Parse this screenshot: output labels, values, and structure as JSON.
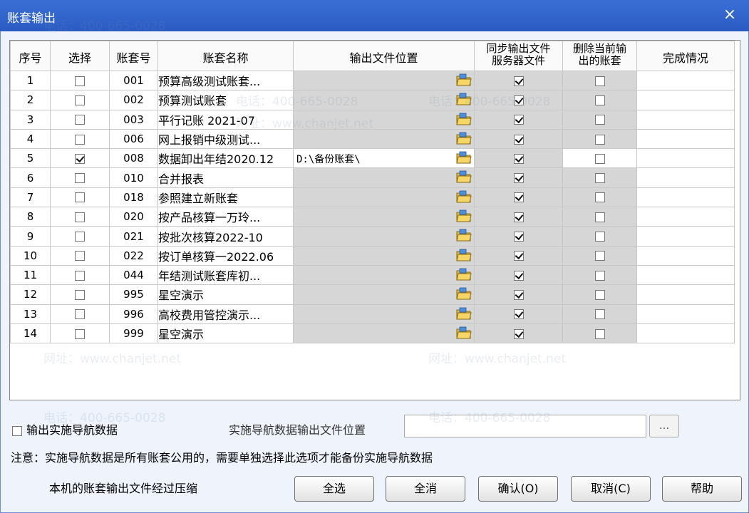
{
  "window": {
    "title": "账套输出",
    "close_label": "×"
  },
  "columns": [
    "序号",
    "选择",
    "账套号",
    "账套名称",
    "输出文件位置",
    "同步输出文件服务器文件",
    "删除当前输出的账套",
    "完成情况"
  ],
  "columns_display": {
    "sync_line1": "同步输出文件",
    "sync_line2": "服务器文件",
    "del_line1": "删除当前输",
    "del_line2": "出的账套"
  },
  "rows": [
    {
      "no": "1",
      "selected": false,
      "code": "001",
      "name": "预算高级测试账套...",
      "path": "",
      "sync": true,
      "delete": false,
      "status": ""
    },
    {
      "no": "2",
      "selected": false,
      "code": "002",
      "name": "预算测试账套",
      "path": "",
      "sync": true,
      "delete": false,
      "status": ""
    },
    {
      "no": "3",
      "selected": false,
      "code": "003",
      "name": "平行记账 2021-07",
      "path": "",
      "sync": true,
      "delete": false,
      "status": ""
    },
    {
      "no": "4",
      "selected": false,
      "code": "006",
      "name": "网上报销中级测试...",
      "path": "",
      "sync": true,
      "delete": false,
      "status": ""
    },
    {
      "no": "5",
      "selected": true,
      "code": "008",
      "name": "数据卸出年结2020.12",
      "path": "D:\\备份账套\\",
      "sync": true,
      "delete": false,
      "status": ""
    },
    {
      "no": "6",
      "selected": false,
      "code": "010",
      "name": "合并报表",
      "path": "",
      "sync": true,
      "delete": false,
      "status": ""
    },
    {
      "no": "7",
      "selected": false,
      "code": "018",
      "name": "参照建立新账套",
      "path": "",
      "sync": true,
      "delete": false,
      "status": ""
    },
    {
      "no": "8",
      "selected": false,
      "code": "020",
      "name": "按产品核算一万玲...",
      "path": "",
      "sync": true,
      "delete": false,
      "status": ""
    },
    {
      "no": "9",
      "selected": false,
      "code": "021",
      "name": "按批次核算2022-10",
      "path": "",
      "sync": true,
      "delete": false,
      "status": ""
    },
    {
      "no": "10",
      "selected": false,
      "code": "022",
      "name": "按订单核算一2022.06",
      "path": "",
      "sync": true,
      "delete": false,
      "status": ""
    },
    {
      "no": "11",
      "selected": false,
      "code": "044",
      "name": "年结测试账套库初...",
      "path": "",
      "sync": true,
      "delete": false,
      "status": ""
    },
    {
      "no": "12",
      "selected": false,
      "code": "995",
      "name": "星空演示",
      "path": "",
      "sync": true,
      "delete": false,
      "status": ""
    },
    {
      "no": "13",
      "selected": false,
      "code": "996",
      "name": "高校费用管控演示...",
      "path": "",
      "sync": true,
      "delete": false,
      "status": ""
    },
    {
      "no": "14",
      "selected": false,
      "code": "999",
      "name": "星空演示",
      "path": "",
      "sync": true,
      "delete": false,
      "status": ""
    }
  ],
  "nav": {
    "checkbox_label": "输出实施导航数据",
    "checked": false,
    "location_label": "实施导航数据输出文件位置",
    "location_value": "",
    "browse_label": "..."
  },
  "note": "注意：实施导航数据是所有账套公用的，需要单独选择此选项才能备份实施导航数据",
  "compress_text": "本机的账套输出文件经过压缩",
  "buttons": {
    "select_all": "全选",
    "deselect_all": "全消",
    "confirm": "确认(O)",
    "cancel": "取消(C)",
    "help": "帮助"
  },
  "watermark": {
    "phone": "电话：400-665-0028",
    "site": "网址：www.chanjet.net"
  }
}
